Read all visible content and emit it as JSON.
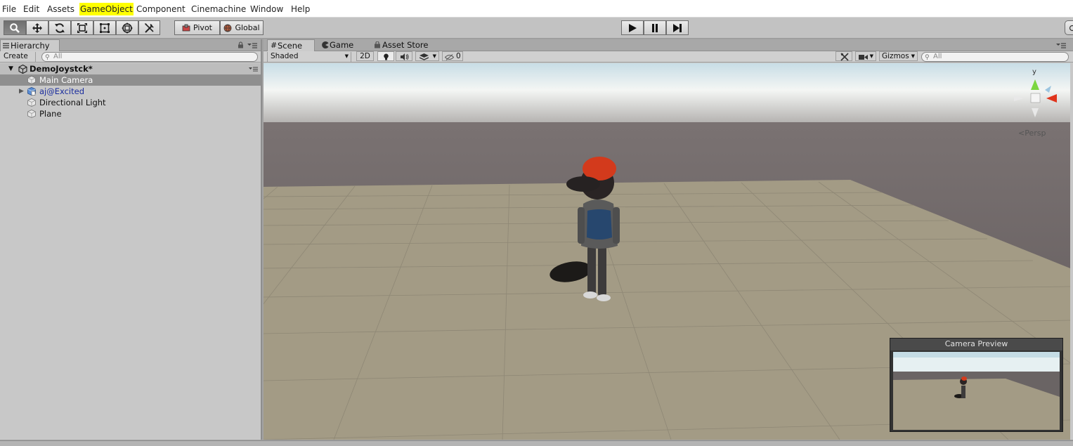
{
  "menubar": {
    "items": [
      "File",
      "Edit",
      "Assets",
      "GameObject",
      "Component",
      "Cinemachine",
      "Window",
      "Help"
    ],
    "highlighted": "GameObject",
    "highlight_color": "#ffff00"
  },
  "toolbar": {
    "tools": [
      "hand-tool-icon",
      "move-tool-icon",
      "rotate-tool-icon",
      "scale-tool-icon",
      "rect-tool-icon",
      "transform-tool-icon",
      "custom-tool-icon"
    ],
    "active_tool": "hand-tool-icon",
    "pivot_label": "Pivot",
    "global_label": "Global",
    "play_icons": [
      "play-icon",
      "pause-icon",
      "step-icon"
    ]
  },
  "hierarchy": {
    "tab_label": "Hierarchy",
    "create_label": "Create",
    "search_placeholder": "All",
    "scene_name": "DemoJoystck*",
    "items": [
      {
        "label": "Main Camera",
        "selected": true,
        "prefab": false
      },
      {
        "label": "aj@Excited",
        "selected": false,
        "prefab": true
      },
      {
        "label": "Directional Light",
        "selected": false,
        "prefab": false
      },
      {
        "label": "Plane",
        "selected": false,
        "prefab": false
      }
    ]
  },
  "scene": {
    "tabs": [
      {
        "label": "Scene",
        "icon": "grid-icon",
        "active": true
      },
      {
        "label": "Game",
        "icon": "pacman-icon",
        "active": false
      },
      {
        "label": "Asset Store",
        "icon": "bag-icon",
        "active": false
      }
    ],
    "shading_mode": "Shaded",
    "mode_2d_label": "2D",
    "hidden_count": "0",
    "gizmos_label": "Gizmos",
    "search_placeholder": "All",
    "projection_label": "Persp",
    "gizmo_axis_label": "y",
    "camera_preview_title": "Camera Preview"
  },
  "colors": {
    "selection": "#8f8f8f",
    "prefab_text": "#1a2d9e",
    "ground": "#a39b85",
    "horizon": "#5e5758",
    "hat": "#d33a1c"
  }
}
